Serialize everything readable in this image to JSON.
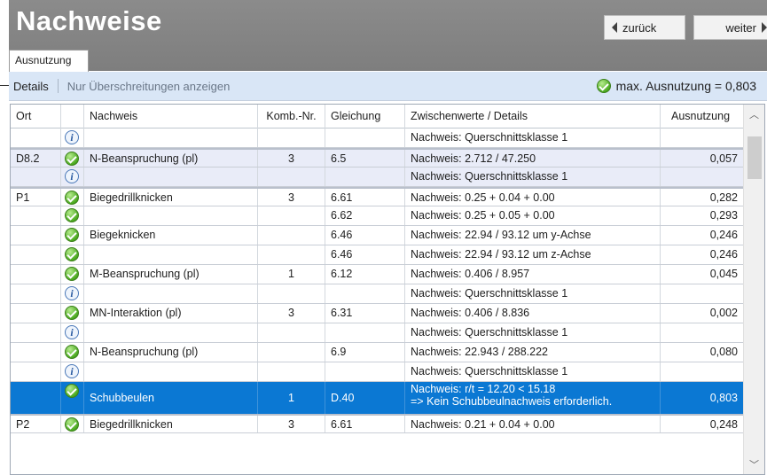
{
  "header": {
    "title": "Nachweise",
    "back_label": "zurück",
    "next_label": "weiter"
  },
  "tabs": [
    {
      "label": "Ausnutzung"
    }
  ],
  "toolbar": {
    "details_label": "Details",
    "only_exceed_label": "Nur Überschreitungen anzeigen",
    "max_label": "max. Ausnutzung = 0,803"
  },
  "table": {
    "columns": [
      "Ort",
      "",
      "Nachweis",
      "Komb.-Nr.",
      "Gleichung",
      "Zwischenwerte / Details",
      "Ausnutzung"
    ],
    "rows": [
      {
        "ort": "",
        "icon": "info-icon",
        "nachweis": "",
        "komb": "",
        "gleichung": "",
        "zw": "Nachweis: Querschnittsklasse 1",
        "zw2": "",
        "aus": ""
      },
      {
        "ort": "D8.2",
        "icon": "check-icon",
        "nachweis": "N-Beanspruchung (pl)",
        "komb": "3",
        "gleichung": "6.5",
        "zw": "Nachweis: 2.712 / 47.250",
        "zw2": "",
        "aus": "0,057"
      },
      {
        "ort": "",
        "icon": "info-icon",
        "nachweis": "",
        "komb": "",
        "gleichung": "",
        "zw": "Nachweis: Querschnittsklasse 1",
        "zw2": "",
        "aus": ""
      },
      {
        "ort": "P1",
        "icon": "check-icon",
        "nachweis": "Biegedrillknicken",
        "komb": "3",
        "gleichung": "6.61",
        "zw": "Nachweis: 0.25 + 0.04 + 0.00",
        "zw2": "",
        "aus": "0,282"
      },
      {
        "ort": "",
        "icon": "check-icon",
        "nachweis": "",
        "komb": "",
        "gleichung": "6.62",
        "zw": "Nachweis: 0.25 + 0.05 + 0.00",
        "zw2": "",
        "aus": "0,293"
      },
      {
        "ort": "",
        "icon": "check-icon",
        "nachweis": "Biegeknicken",
        "komb": "",
        "gleichung": "6.46",
        "zw": "Nachweis: 22.94 / 93.12 um y-Achse",
        "zw2": "",
        "aus": "0,246"
      },
      {
        "ort": "",
        "icon": "check-icon",
        "nachweis": "",
        "komb": "",
        "gleichung": "6.46",
        "zw": "Nachweis: 22.94 / 93.12 um z-Achse",
        "zw2": "",
        "aus": "0,246"
      },
      {
        "ort": "",
        "icon": "check-icon",
        "nachweis": "M-Beanspruchung (pl)",
        "komb": "1",
        "gleichung": "6.12",
        "zw": "Nachweis: 0.406 / 8.957",
        "zw2": "",
        "aus": "0,045"
      },
      {
        "ort": "",
        "icon": "info-icon",
        "nachweis": "",
        "komb": "",
        "gleichung": "",
        "zw": "Nachweis: Querschnittsklasse 1",
        "zw2": "",
        "aus": ""
      },
      {
        "ort": "",
        "icon": "check-icon",
        "nachweis": "MN-Interaktion (pl)",
        "komb": "3",
        "gleichung": "6.31",
        "zw": "Nachweis: 0.406 / 8.836",
        "zw2": "",
        "aus": "0,002"
      },
      {
        "ort": "",
        "icon": "info-icon",
        "nachweis": "",
        "komb": "",
        "gleichung": "",
        "zw": "Nachweis: Querschnittsklasse 1",
        "zw2": "",
        "aus": ""
      },
      {
        "ort": "",
        "icon": "check-icon",
        "nachweis": "N-Beanspruchung (pl)",
        "komb": "",
        "gleichung": "6.9",
        "zw": "Nachweis: 22.943 / 288.222",
        "zw2": "",
        "aus": "0,080"
      },
      {
        "ort": "",
        "icon": "info-icon",
        "nachweis": "",
        "komb": "",
        "gleichung": "",
        "zw": "Nachweis: Querschnittsklasse 1",
        "zw2": "",
        "aus": ""
      },
      {
        "ort": "",
        "icon": "check-icon",
        "nachweis": "Schubbeulen",
        "komb": "1",
        "gleichung": "D.40",
        "zw": "Nachweis: r/t = 12.20 < 15.18",
        "zw2": "=> Kein Schubbeulnachweis erforderlich.",
        "aus": "0,803"
      },
      {
        "ort": "P2",
        "icon": "check-icon",
        "nachweis": "Biegedrillknicken",
        "komb": "3",
        "gleichung": "6.61",
        "zw": "Nachweis: 0.21 + 0.04 + 0.00",
        "zw2": "",
        "aus": "0,248"
      }
    ]
  },
  "colors": {
    "header_bg": "#858585",
    "toolbar_bg": "#d9e6f6",
    "alt_row": "#e9ecf8",
    "selected_row": "#0b78d3",
    "ok_green": "#4caa21"
  }
}
